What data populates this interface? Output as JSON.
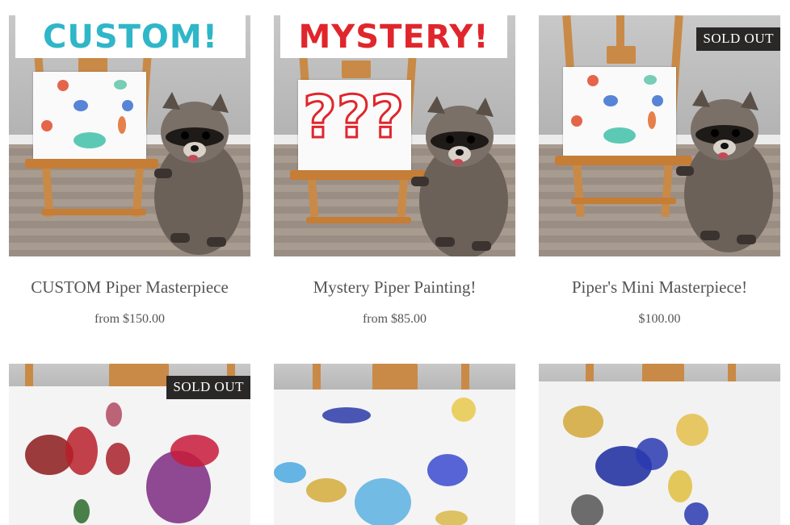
{
  "products": [
    {
      "title": "CUSTOM Piper Masterpiece",
      "price_prefix": "from",
      "price": "$150.00",
      "banner": "CUSTOM!",
      "banner_color": "#2fb6c8",
      "sold_out": false
    },
    {
      "title": "Mystery Piper Painting!",
      "price_prefix": "from",
      "price": "$85.00",
      "banner": "MYSTERY!",
      "banner_color": "#e0262c",
      "sold_out": false
    },
    {
      "title": "Piper's Mini Masterpiece!",
      "price_prefix": "",
      "price": "$100.00",
      "sold_out": true,
      "badge": "SOLD OUT"
    },
    {
      "sold_out": true,
      "badge": "SOLD OUT"
    },
    {
      "sold_out": false
    },
    {
      "sold_out": false
    }
  ],
  "icons": {
    "qmarks": "???"
  }
}
